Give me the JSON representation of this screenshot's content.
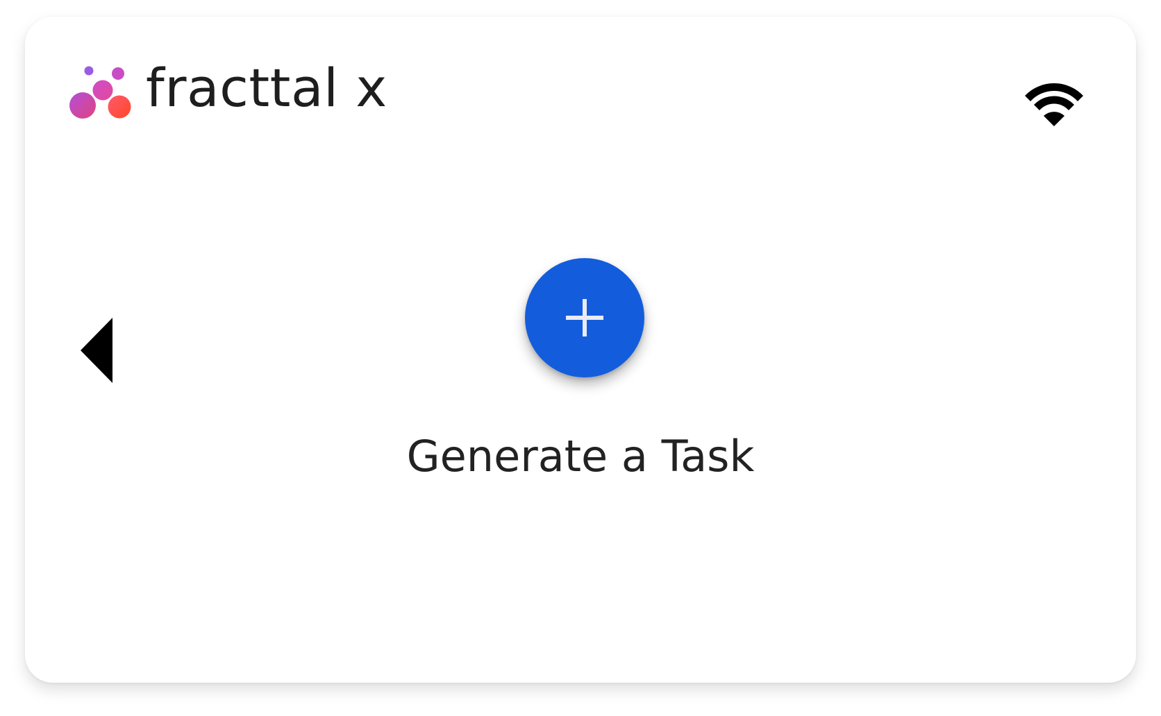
{
  "app": {
    "brand_name": "fracttal x",
    "brand_colors": [
      "#8f5ee8",
      "#c04bc5",
      "#e0437f",
      "#ff4a3a"
    ]
  },
  "status_bar": {
    "wifi_icon": "wifi-icon"
  },
  "navigation": {
    "back_icon": "triangle-left-icon"
  },
  "main": {
    "action_icon": "plus-icon",
    "action_color": "#135ddc",
    "action_label": "Generate a Task"
  }
}
